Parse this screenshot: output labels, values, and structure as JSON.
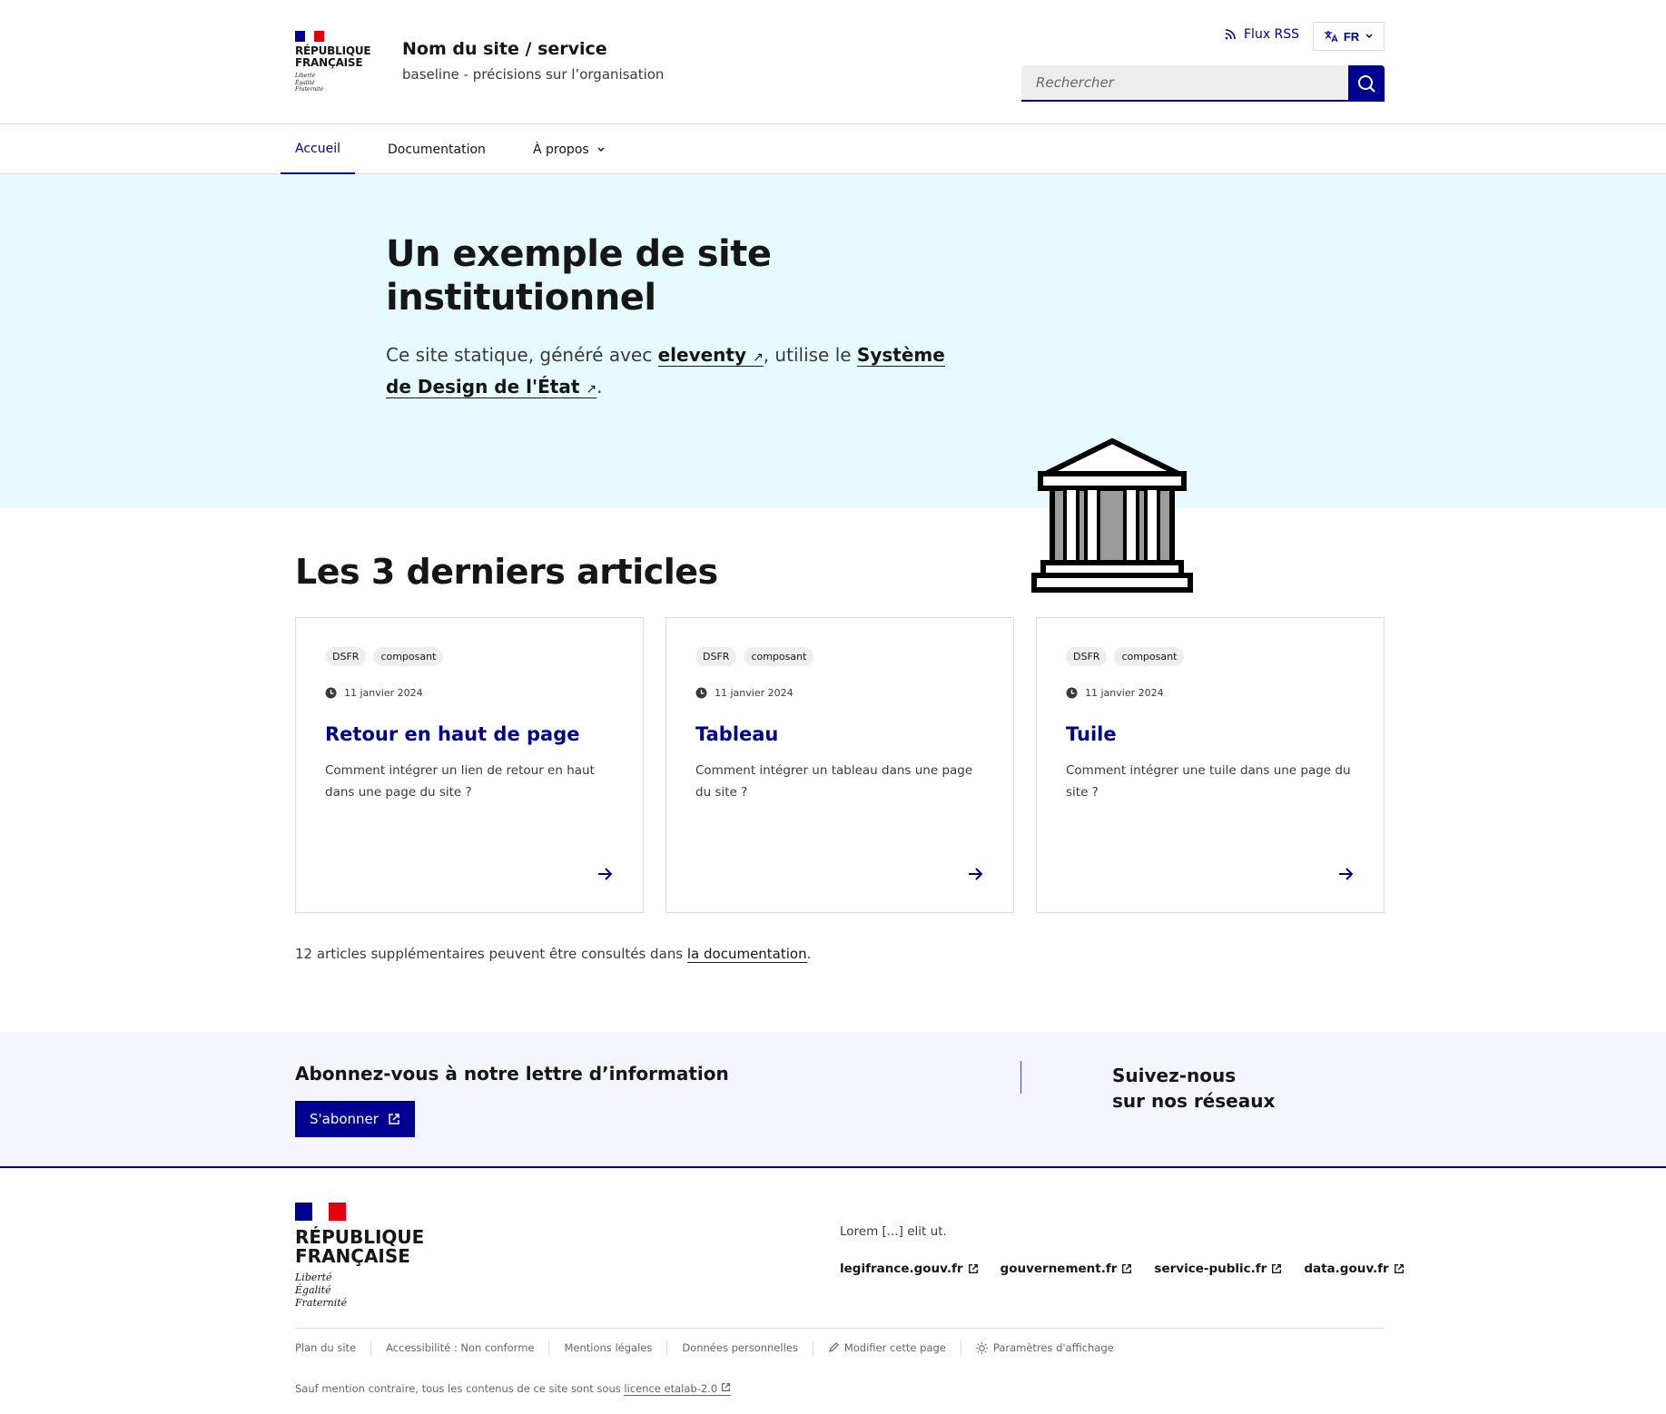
{
  "header": {
    "republique": "RÉPUBLIQUE\nFRANÇAISE",
    "devise": [
      "Liberté",
      "Égalité",
      "Fraternité"
    ],
    "site_title": "Nom du site / service",
    "baseline": "baseline - précisions sur l’organisation",
    "rss_label": "Flux RSS",
    "lang_label": "FR",
    "search_placeholder": "Rechercher"
  },
  "nav": {
    "items": [
      {
        "label": "Accueil"
      },
      {
        "label": "Documentation"
      },
      {
        "label": "À propos"
      }
    ]
  },
  "hero": {
    "title": "Un exemple de site institutionnel",
    "text_before": "Ce site statique, généré avec ",
    "link1": "eleventy",
    "text_middle": ", utilise le ",
    "link2": "Système de Design de l'État",
    "text_after": "."
  },
  "articles": {
    "section_title": "Les 3 derniers articles",
    "cards": [
      {
        "tags": [
          "DSFR",
          "composant"
        ],
        "date": "11 janvier 2024",
        "title": "Retour en haut de page",
        "desc": "Comment intégrer un lien de retour en haut dans une page du site ?"
      },
      {
        "tags": [
          "DSFR",
          "composant"
        ],
        "date": "11 janvier 2024",
        "title": "Tableau",
        "desc": "Comment intégrer un tableau dans une page du site ?"
      },
      {
        "tags": [
          "DSFR",
          "composant"
        ],
        "date": "11 janvier 2024",
        "title": "Tuile",
        "desc": "Comment intégrer une tuile dans une page du site ?"
      }
    ],
    "more_text": "12 articles supplémentaires peuvent être consultés dans ",
    "more_link": "la documentation",
    "more_end": "."
  },
  "follow": {
    "newsletter_title": "Abonnez-vous à notre lettre d’information",
    "subscribe_label": "S'abonner",
    "social_title": "Suivez-nous\nsur nos réseaux"
  },
  "footer": {
    "republique": "RÉPUBLIQUE\nFRANÇAISE",
    "devise": [
      "Liberté",
      "Égalité",
      "Fraternité"
    ],
    "desc": "Lorem [...] elit ut.",
    "links": [
      "legifrance.gouv.fr",
      "gouvernement.fr",
      "service-public.fr",
      "data.gouv.fr"
    ],
    "bottom": [
      "Plan du site",
      "Accessibilité : Non conforme",
      "Mentions légales",
      "Données personnelles",
      "Modifier cette page",
      "Paramètres d'affichage"
    ],
    "license_text": "Sauf mention contraire, tous les contenus de ce site sont sous ",
    "license_link": "licence etalab-2.0"
  },
  "colors": {
    "primary": "#000091",
    "hero_bg": "#e5fbfd",
    "follow_bg": "#f5f5fe",
    "marianne_red": "#e1000f"
  }
}
